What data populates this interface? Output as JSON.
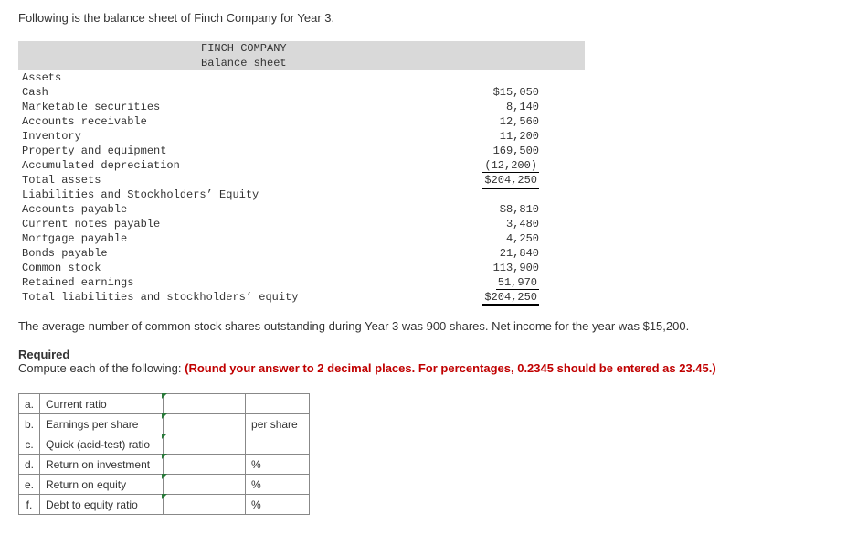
{
  "intro": "Following is the balance sheet of Finch Company for Year 3.",
  "company_header": {
    "name": "FINCH COMPANY",
    "title": "Balance sheet"
  },
  "assets_section": "Assets",
  "assets": [
    {
      "label": "Cash",
      "value": "$15,050"
    },
    {
      "label": "Marketable securities",
      "value": "8,140"
    },
    {
      "label": "Accounts receivable",
      "value": "12,560"
    },
    {
      "label": "Inventory",
      "value": "11,200"
    },
    {
      "label": "Property and equipment",
      "value": "169,500"
    },
    {
      "label": "Accumulated depreciation",
      "value": "(12,200)"
    }
  ],
  "total_assets": {
    "label": "Total assets",
    "value": "$204,250"
  },
  "liab_section": "Liabilities and Stockholders’ Equity",
  "liabilities": [
    {
      "label": "Accounts payable",
      "value": "$8,810"
    },
    {
      "label": "Current notes payable",
      "value": "3,480"
    },
    {
      "label": "Mortgage payable",
      "value": "4,250"
    },
    {
      "label": "Bonds payable",
      "value": "21,840"
    },
    {
      "label": "Common stock",
      "value": "113,900"
    },
    {
      "label": "Retained earnings",
      "value": "51,970"
    }
  ],
  "total_liab": {
    "label": "Total liabilities and stockholders’ equity",
    "value": "$204,250"
  },
  "after_text": "The average number of common stock shares outstanding during Year 3 was 900 shares. Net income for the year was $15,200.",
  "required_label": "Required",
  "required_text": "Compute each of the following: ",
  "required_red": "(Round your answer to 2 decimal places. For percentages, 0.2345 should be entered as 23.45.)",
  "answers": [
    {
      "letter": "a.",
      "label": "Current ratio",
      "unit": ""
    },
    {
      "letter": "b.",
      "label": "Earnings per share",
      "unit": "per share"
    },
    {
      "letter": "c.",
      "label": "Quick (acid-test) ratio",
      "unit": ""
    },
    {
      "letter": "d.",
      "label": "Return on investment",
      "unit": "%"
    },
    {
      "letter": "e.",
      "label": "Return on equity",
      "unit": "%"
    },
    {
      "letter": "f.",
      "label": "Debt to equity ratio",
      "unit": "%"
    }
  ]
}
